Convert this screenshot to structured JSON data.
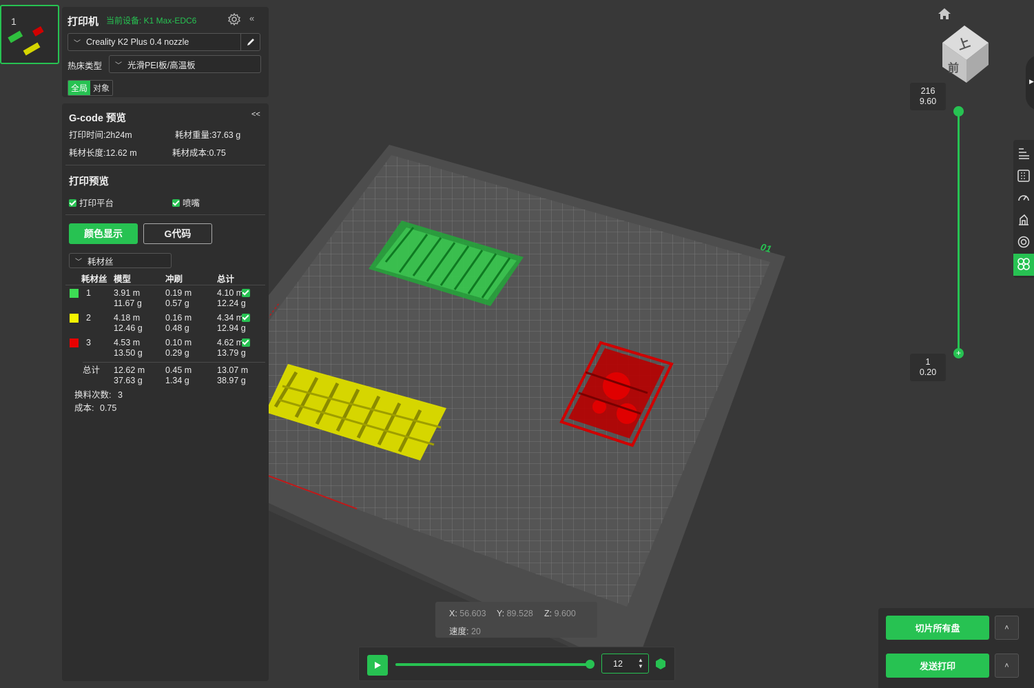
{
  "plate": {
    "number": "1"
  },
  "printer": {
    "title": "打印机",
    "current_device": "当前设备: K1 Max-EDC6",
    "collapse": "«",
    "printer_name": "Creality K2 Plus 0.4 nozzle",
    "bed_label": "热床类型",
    "bed_type": "光滑PEI板/高温板",
    "scope_global": "全局",
    "scope_object": "对象"
  },
  "gcode": {
    "title": "G-code 预览",
    "collapse": "<<",
    "print_time": "打印时间:2h24m",
    "filament_weight": "耗材重量:37.63 g",
    "filament_length": "耗材长度:12.62 m",
    "filament_cost": "耗材成本:0.75"
  },
  "preview": {
    "title": "打印预览",
    "show_bed": "打印平台",
    "show_nozzle": "喷嘴",
    "color_display_btn": "颜色显示",
    "gcode_btn": "G代码",
    "filament_dropdown": "耗材丝"
  },
  "table": {
    "headers": [
      "耗材丝",
      "模型",
      "冲刷",
      "总计"
    ],
    "rows": [
      {
        "id": "1",
        "color": "#3ddc54",
        "model_len": "3.91 m",
        "model_wt": "11.67 g",
        "flush_len": "0.19 m",
        "flush_wt": "0.57 g",
        "total_len": "4.10 m",
        "total_wt": "12.24 g"
      },
      {
        "id": "2",
        "color": "#f5f500",
        "model_len": "4.18 m",
        "model_wt": "12.46 g",
        "flush_len": "0.16 m",
        "flush_wt": "0.48 g",
        "total_len": "4.34 m",
        "total_wt": "12.94 g"
      },
      {
        "id": "3",
        "color": "#e80000",
        "model_len": "4.53 m",
        "model_wt": "13.50 g",
        "flush_len": "0.10 m",
        "flush_wt": "0.29 g",
        "total_len": "4.62 m",
        "total_wt": "13.79 g"
      }
    ],
    "sum": {
      "label": "总计",
      "model_len": "12.62 m",
      "model_wt": "37.63 g",
      "flush_len": "0.45 m",
      "flush_wt": "1.34 g",
      "total_len": "13.07 m",
      "total_wt": "38.97 g"
    },
    "changes_label": "换料次数:",
    "changes_value": "3",
    "cost_label": "成本:",
    "cost_value": "0.75"
  },
  "viewport": {
    "plate_label": "01",
    "cube_top": "上",
    "cube_front": "前"
  },
  "layers": {
    "top_layer": "216",
    "top_height": "9.60",
    "bottom_layer": "1",
    "bottom_height": "0.20"
  },
  "coords": {
    "x_label": "X:",
    "x_value": "56.603",
    "y_label": "Y:",
    "y_value": "89.528",
    "z_label": "Z:",
    "z_value": "9.600",
    "speed_label": "速度:",
    "speed_value": "20"
  },
  "playback": {
    "step": "12"
  },
  "actions": {
    "slice_all": "切片所有盘",
    "send_print": "发送打印",
    "more": "˄"
  },
  "colors": {
    "accent": "#27c252"
  }
}
